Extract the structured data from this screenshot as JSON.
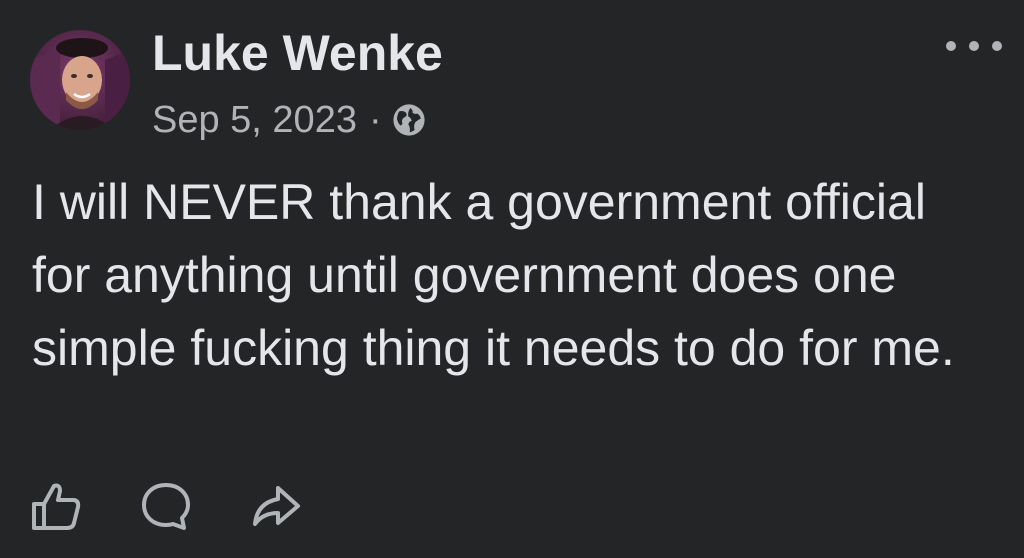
{
  "post": {
    "author": {
      "name": "Luke Wenke",
      "avatar_icon": "profile-photo"
    },
    "date": "Sep 5, 2023",
    "separator": "·",
    "audience_icon": "globe-icon",
    "text": "I will NEVER thank a government official for anything until government does one simple fucking thing it needs to do for me.",
    "more_icon": "more-options-icon"
  },
  "actions": [
    {
      "icon": "like-icon"
    },
    {
      "icon": "comment-icon"
    },
    {
      "icon": "share-icon"
    }
  ],
  "colors": {
    "background": "#242526",
    "primary_text": "#e4e6eb",
    "secondary_text": "#b0b3b8"
  }
}
